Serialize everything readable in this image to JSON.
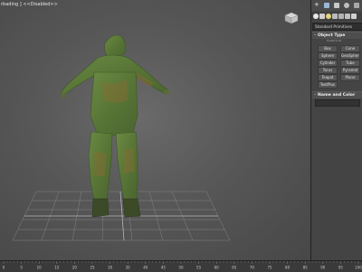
{
  "viewport": {
    "label": "rbading ] <<Disabled>>"
  },
  "command_panel": {
    "category": "Standard Primitives",
    "object_type_title": "Object Type",
    "autogrid": "AutoGrid",
    "buttons": [
      "Box",
      "Cone",
      "Sphere",
      "GeoSphere",
      "Cylinder",
      "Tube",
      "Torus",
      "Pyramid",
      "Teapot",
      "Plane",
      "TextPlus"
    ],
    "name_color_title": "Name and Color",
    "collapse_symbol": "–"
  },
  "timeline": {
    "ticks": [
      "0",
      "5",
      "10",
      "15",
      "20",
      "25",
      "30",
      "35",
      "40",
      "45",
      "50",
      "55",
      "60",
      "65",
      "70",
      "75",
      "80",
      "85",
      "90",
      "95",
      "100"
    ]
  },
  "colors": {
    "viewport_bg": "#575757",
    "suit_green": "#5c7a3a",
    "suit_rust": "#8a6a34",
    "panel_bg": "#444444"
  }
}
